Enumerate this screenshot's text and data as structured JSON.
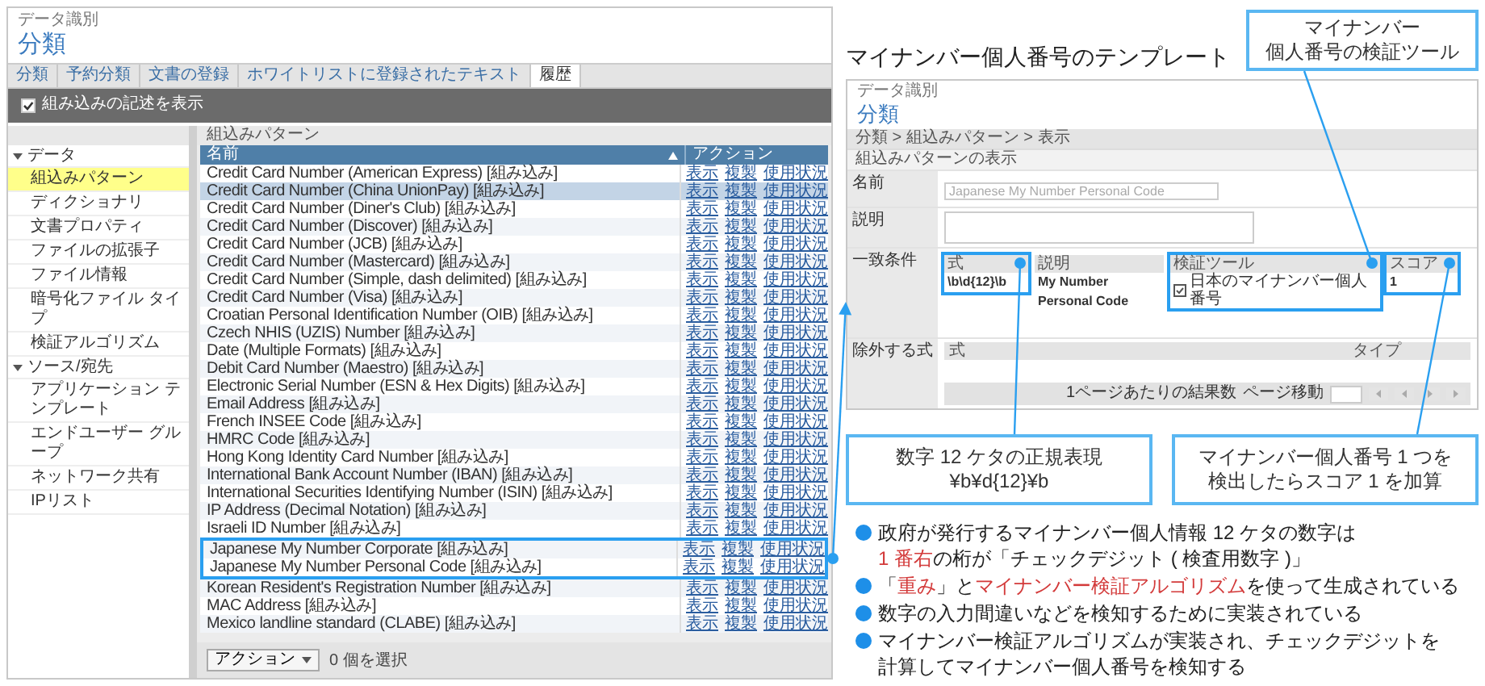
{
  "left_screen": {
    "section": "データ識別",
    "title": "分類",
    "tabs": [
      {
        "label": "分類",
        "selected": false
      },
      {
        "label": "予約分類",
        "selected": false
      },
      {
        "label": "文書の登録",
        "selected": false
      },
      {
        "label": "ホワイトリストに登録されたテキスト",
        "selected": false
      },
      {
        "label": "履歴",
        "selected": true
      }
    ],
    "toolbar": {
      "label": "組み込みの記述を表示",
      "checked": true
    },
    "sidebar": [
      {
        "label": "データ",
        "expanded": true,
        "children": [
          {
            "label": "組込みパターン",
            "selected": true
          },
          {
            "label": "ディクショナリ",
            "selected": false
          },
          {
            "label": "文書プロパティ",
            "selected": false
          },
          {
            "label": "ファイルの拡張子",
            "selected": false
          },
          {
            "label": "ファイル情報",
            "selected": false
          },
          {
            "label": "暗号化ファイル タイプ",
            "selected": false
          },
          {
            "label": "検証アルゴリズム",
            "selected": false
          }
        ]
      },
      {
        "label": "ソース/宛先",
        "expanded": true,
        "children": [
          {
            "label": "アプリケーション テンプレート",
            "selected": false
          },
          {
            "label": "エンドユーザー グループ",
            "selected": false
          },
          {
            "label": "ネットワーク共有",
            "selected": false
          },
          {
            "label": "IPリスト",
            "selected": false
          }
        ]
      }
    ],
    "panel_title": "組込みパターン",
    "columns": [
      "名前",
      "アクション"
    ],
    "rows": [
      {
        "name": "Credit Card Number (American Express) [組み込み]",
        "actions": [
          "表示",
          "複製",
          "使用状況"
        ],
        "selected": false,
        "highlighted": false
      },
      {
        "name": "Credit Card Number (China UnionPay) [組み込み]",
        "actions": [
          "表示",
          "複製",
          "使用状況"
        ],
        "selected": true,
        "highlighted": false
      },
      {
        "name": "Credit Card Number (Diner's Club) [組み込み]",
        "actions": [
          "表示",
          "複製",
          "使用状況"
        ],
        "selected": false,
        "highlighted": false
      },
      {
        "name": "Credit Card Number (Discover) [組み込み]",
        "actions": [
          "表示",
          "複製",
          "使用状況"
        ],
        "selected": false,
        "highlighted": false
      },
      {
        "name": "Credit Card Number (JCB) [組み込み]",
        "actions": [
          "表示",
          "複製",
          "使用状況"
        ],
        "selected": false,
        "highlighted": false
      },
      {
        "name": "Credit Card Number (Mastercard) [組み込み]",
        "actions": [
          "表示",
          "複製",
          "使用状況"
        ],
        "selected": false,
        "highlighted": false
      },
      {
        "name": "Credit Card Number (Simple, dash delimited) [組み込み]",
        "actions": [
          "表示",
          "複製",
          "使用状況"
        ],
        "selected": false,
        "highlighted": false
      },
      {
        "name": "Credit Card Number (Visa) [組み込み]",
        "actions": [
          "表示",
          "複製",
          "使用状況"
        ],
        "selected": false,
        "highlighted": false
      },
      {
        "name": "Croatian Personal Identification Number (OIB) [組み込み]",
        "actions": [
          "表示",
          "複製",
          "使用状況"
        ],
        "selected": false,
        "highlighted": false
      },
      {
        "name": "Czech NHIS (UZIS) Number [組み込み]",
        "actions": [
          "表示",
          "複製",
          "使用状況"
        ],
        "selected": false,
        "highlighted": false
      },
      {
        "name": "Date (Multiple Formats) [組み込み]",
        "actions": [
          "表示",
          "複製",
          "使用状況"
        ],
        "selected": false,
        "highlighted": false
      },
      {
        "name": "Debit Card Number (Maestro) [組み込み]",
        "actions": [
          "表示",
          "複製",
          "使用状況"
        ],
        "selected": false,
        "highlighted": false
      },
      {
        "name": "Electronic Serial Number (ESN & Hex Digits) [組み込み]",
        "actions": [
          "表示",
          "複製",
          "使用状況"
        ],
        "selected": false,
        "highlighted": false
      },
      {
        "name": "Email Address [組み込み]",
        "actions": [
          "表示",
          "複製",
          "使用状況"
        ],
        "selected": false,
        "highlighted": false
      },
      {
        "name": "French INSEE Code [組み込み]",
        "actions": [
          "表示",
          "複製",
          "使用状況"
        ],
        "selected": false,
        "highlighted": false
      },
      {
        "name": "HMRC Code [組み込み]",
        "actions": [
          "表示",
          "複製",
          "使用状況"
        ],
        "selected": false,
        "highlighted": false
      },
      {
        "name": "Hong Kong Identity Card Number [組み込み]",
        "actions": [
          "表示",
          "複製",
          "使用状況"
        ],
        "selected": false,
        "highlighted": false
      },
      {
        "name": "International Bank Account Number (IBAN) [組み込み]",
        "actions": [
          "表示",
          "複製",
          "使用状況"
        ],
        "selected": false,
        "highlighted": false
      },
      {
        "name": "International Securities Identifying Number (ISIN) [組み込み]",
        "actions": [
          "表示",
          "複製",
          "使用状況"
        ],
        "selected": false,
        "highlighted": false
      },
      {
        "name": "IP Address (Decimal Notation) [組み込み]",
        "actions": [
          "表示",
          "複製",
          "使用状況"
        ],
        "selected": false,
        "highlighted": false
      },
      {
        "name": "Israeli ID Number [組み込み]",
        "actions": [
          "表示",
          "複製",
          "使用状況"
        ],
        "selected": false,
        "highlighted": false
      },
      {
        "name": "Japanese My Number Corporate [組み込み]",
        "actions": [
          "表示",
          "複製",
          "使用状況"
        ],
        "selected": false,
        "highlighted": true
      },
      {
        "name": "Japanese My Number Personal Code [組み込み]",
        "actions": [
          "表示",
          "複製",
          "使用状況"
        ],
        "selected": false,
        "highlighted": true
      },
      {
        "name": "Korean Resident's Registration Number [組み込み]",
        "actions": [
          "表示",
          "複製",
          "使用状況"
        ],
        "selected": false,
        "highlighted": false
      },
      {
        "name": "MAC Address [組み込み]",
        "actions": [
          "表示",
          "複製",
          "使用状況"
        ],
        "selected": false,
        "highlighted": false
      },
      {
        "name": "Mexico landline standard (CLABE) [組み込み]",
        "actions": [
          "表示",
          "複製",
          "使用状況"
        ],
        "selected": false,
        "highlighted": false
      }
    ],
    "footer": {
      "button": "アクション",
      "note": "0 個を選択"
    }
  },
  "title": "マイナンバー個人番号のテンプレート",
  "right_screen": {
    "section": "データ識別",
    "title": "分類",
    "breadcrumb": "分類 > 組込みパターン > 表示",
    "heading": "組込みパターンの表示",
    "name_field": {
      "label": "名前",
      "value": "Japanese My Number Personal Code"
    },
    "description_field": {
      "label": "説明"
    },
    "match": {
      "label": "一致条件",
      "columns": [
        {
          "label": "式",
          "kind": "text",
          "highlighted": true,
          "cell": "\\b\\d{12}\\b",
          "callout_below": {
            "lines": [
              "数字 12 ケタの正規表現",
              "¥b¥d{12}¥b"
            ]
          }
        },
        {
          "label": "説明",
          "kind": "text",
          "highlighted": false,
          "cell": "My Number Personal Code"
        },
        {
          "label": "検証ツール",
          "kind": "validator",
          "highlighted": true,
          "cell": "日本のマイナンバー個人番号",
          "callout_above": {
            "lines": [
              "マイナンバー",
              "個人番号の検証ツール"
            ]
          }
        },
        {
          "label": "スコア",
          "kind": "text",
          "highlighted": true,
          "cell": "1",
          "callout_below": {
            "lines": [
              "マイナンバー個人番号 1 つを",
              "検出したらスコア 1 を加算"
            ]
          }
        }
      ]
    },
    "exclude": {
      "label": "除外する式",
      "columns": [
        "式",
        "タイプ"
      ],
      "per_page": "1ページあたりの結果数",
      "goto": "ページ移動"
    }
  },
  "bullets": [
    {
      "lines": [
        [
          {
            "text": "政府が発行するマイナンバー個人情報 12 ケタの数字は",
            "emphasis": false
          }
        ],
        [
          {
            "text": "1 番右",
            "emphasis": true
          },
          {
            "text": "の桁が「チェックデジット ( 検査用数字 )」",
            "emphasis": false
          }
        ]
      ]
    },
    {
      "lines": [
        [
          {
            "text": "「",
            "emphasis": false
          },
          {
            "text": "重み",
            "emphasis": true
          },
          {
            "text": "」と",
            "emphasis": false
          },
          {
            "text": "マイナンバー検証アルゴリズム",
            "emphasis": true
          },
          {
            "text": "を使って生成されている",
            "emphasis": false
          }
        ]
      ]
    },
    {
      "lines": [
        [
          {
            "text": "数字の入力間違いなどを検知するために実装されている",
            "emphasis": false
          }
        ]
      ]
    },
    {
      "lines": [
        [
          {
            "text": "マイナンバー検証アルゴリズムが実装され、チェックデジットを",
            "emphasis": false
          }
        ],
        [
          {
            "text": "計算してマイナンバー個人番号を検知する",
            "emphasis": false
          }
        ]
      ]
    }
  ]
}
